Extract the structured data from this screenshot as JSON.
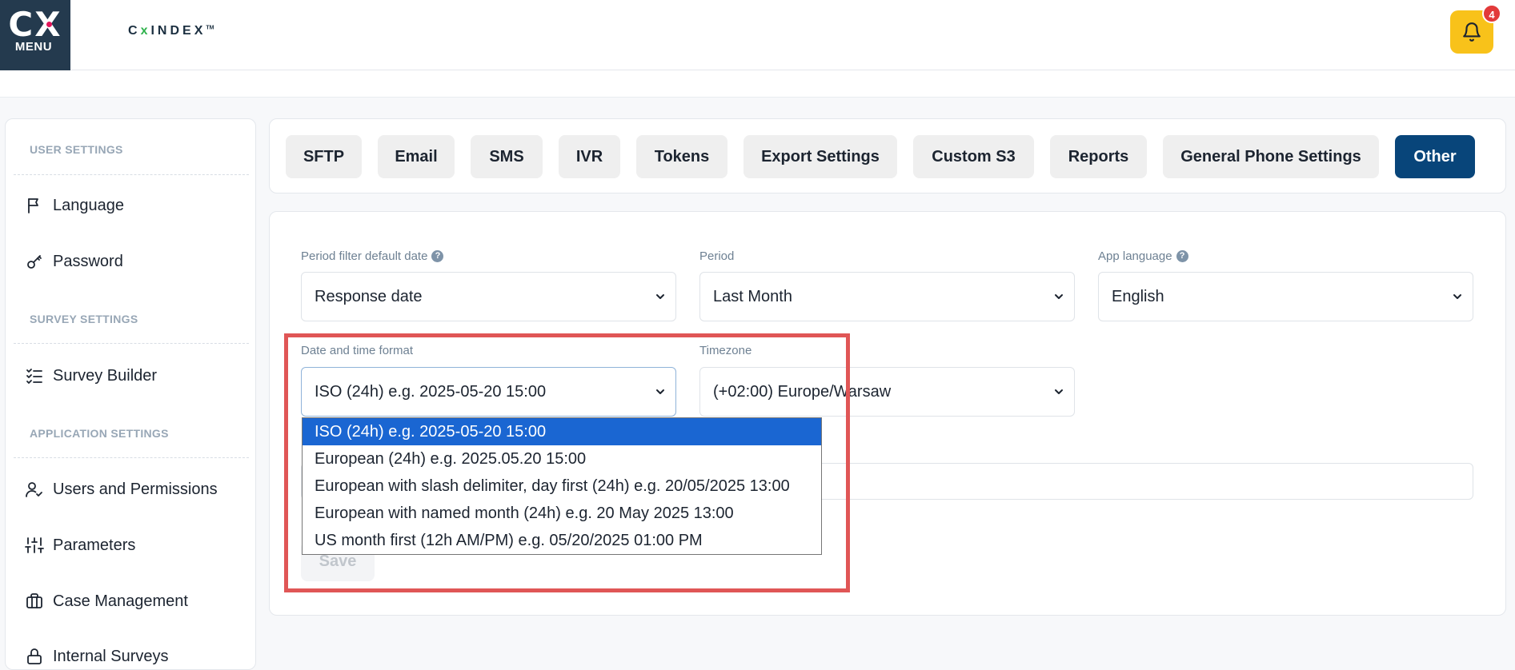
{
  "header": {
    "menu_label": "MENU",
    "menu_logo": "CX",
    "brand_prefix": "C",
    "brand_x": "x",
    "brand_rest": "INDEX",
    "brand_tm": "TM",
    "notification_count": "4"
  },
  "colors": {
    "sidebar_tile": "#243a4e",
    "active_tab": "#08457a",
    "bell": "#f8c21a",
    "badge": "#e23a3a",
    "selected_option": "#1a66d2",
    "highlight_frame": "#e05656"
  },
  "sidebar": {
    "sections": [
      {
        "title": "USER SETTINGS",
        "items": [
          {
            "label": "Language",
            "icon": "flag-icon"
          },
          {
            "label": "Password",
            "icon": "key-icon"
          }
        ]
      },
      {
        "title": "SURVEY SETTINGS",
        "items": [
          {
            "label": "Survey Builder",
            "icon": "checklist-icon"
          }
        ]
      },
      {
        "title": "APPLICATION SETTINGS",
        "items": [
          {
            "label": "Users and Permissions",
            "icon": "user-check-icon"
          },
          {
            "label": "Parameters",
            "icon": "sliders-icon"
          },
          {
            "label": "Case Management",
            "icon": "briefcase-icon"
          },
          {
            "label": "Internal Surveys",
            "icon": "lock-icon"
          }
        ]
      }
    ]
  },
  "tabs": [
    {
      "label": "SFTP",
      "active": false
    },
    {
      "label": "Email",
      "active": false
    },
    {
      "label": "SMS",
      "active": false
    },
    {
      "label": "IVR",
      "active": false
    },
    {
      "label": "Tokens",
      "active": false
    },
    {
      "label": "Export Settings",
      "active": false
    },
    {
      "label": "Custom S3",
      "active": false
    },
    {
      "label": "Reports",
      "active": false
    },
    {
      "label": "General Phone Settings",
      "active": false
    },
    {
      "label": "Other",
      "active": true
    }
  ],
  "form": {
    "period_filter": {
      "label": "Period filter default date",
      "value": "Response date",
      "help": "?"
    },
    "period": {
      "label": "Period",
      "value": "Last Month"
    },
    "app_language": {
      "label": "App language",
      "value": "English",
      "help": "?"
    },
    "date_format": {
      "label": "Date and time format",
      "value": "ISO (24h) e.g. 2025-05-20 15:00",
      "options": [
        "ISO (24h) e.g. 2025-05-20 15:00",
        "European (24h) e.g. 2025.05.20 15:00",
        "European with slash delimiter, day first (24h) e.g. 20/05/2025 13:00",
        "European with named month (24h) e.g. 20 May 2025 13:00",
        "US month first (12h AM/PM) e.g. 05/20/2025 01:00 PM"
      ],
      "selected_index": 0
    },
    "timezone": {
      "label": "Timezone",
      "value": "(+02:00) Europe/Warsaw"
    },
    "save_label": "Save"
  }
}
